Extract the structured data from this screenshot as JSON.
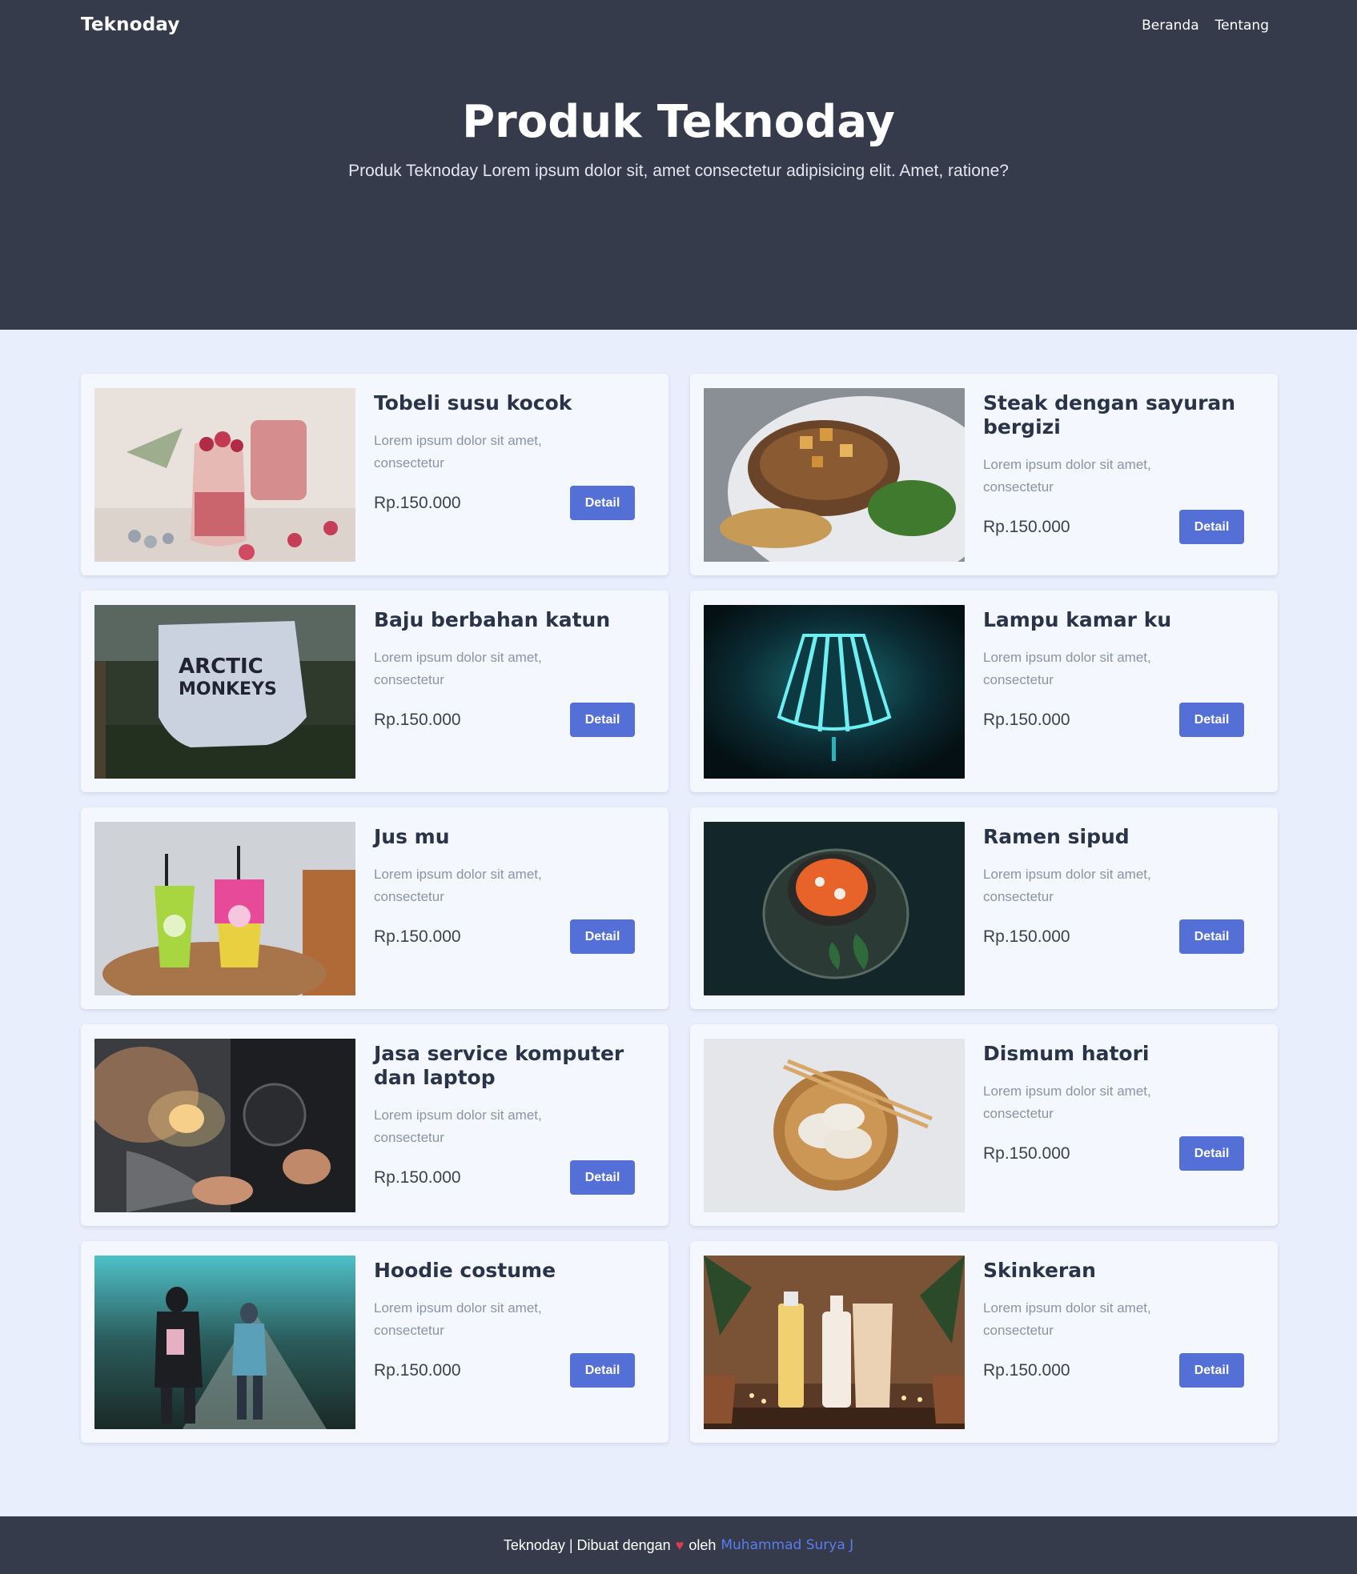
{
  "brand": "Teknoday",
  "nav": {
    "home": "Beranda",
    "about": "Tentang"
  },
  "hero": {
    "title": "Produk Teknoday",
    "subtitle": "Produk Teknoday Lorem ipsum dolor sit, amet consectetur adipisicing elit. Amet, ratione?"
  },
  "products": [
    {
      "title": "Tobeli susu kocok",
      "desc": "Lorem ipsum dolor sit amet, consectetur",
      "price": "Rp.150.000",
      "button": "Detail",
      "image": "smoothie-jars-image"
    },
    {
      "title": "Steak dengan sayuran bergizi",
      "desc": "Lorem ipsum dolor sit amet, consectetur",
      "price": "Rp.150.000",
      "button": "Detail",
      "image": "steak-plate-image"
    },
    {
      "title": "Baju berbahan katun",
      "desc": "Lorem ipsum dolor sit amet, consectetur",
      "price": "Rp.150.000",
      "button": "Detail",
      "image": "tshirt-image"
    },
    {
      "title": "Lampu kamar ku",
      "desc": "Lorem ipsum dolor sit amet, consectetur",
      "price": "Rp.150.000",
      "button": "Detail",
      "image": "lamp-image"
    },
    {
      "title": "Jus mu",
      "desc": "Lorem ipsum dolor sit amet, consectetur",
      "price": "Rp.150.000",
      "button": "Detail",
      "image": "juice-cups-image"
    },
    {
      "title": "Ramen sipud",
      "desc": "Lorem ipsum dolor sit amet, consectetur",
      "price": "Rp.150.000",
      "button": "Detail",
      "image": "ramen-bowl-image"
    },
    {
      "title": "Jasa service komputer dan laptop",
      "desc": "Lorem ipsum dolor sit amet, consectetur",
      "price": "Rp.150.000",
      "button": "Detail",
      "image": "computer-repair-image"
    },
    {
      "title": "Dismum hatori",
      "desc": "Lorem ipsum dolor sit amet, consectetur",
      "price": "Rp.150.000",
      "button": "Detail",
      "image": "dumplings-image"
    },
    {
      "title": "Hoodie costume",
      "desc": "Lorem ipsum dolor sit amet, consectetur",
      "price": "Rp.150.000",
      "button": "Detail",
      "image": "hoodie-walkers-image"
    },
    {
      "title": "Skinkeran",
      "desc": "Lorem ipsum dolor sit amet, consectetur",
      "price": "Rp.150.000",
      "button": "Detail",
      "image": "skincare-bottles-image"
    }
  ],
  "footer": {
    "text_before": "Teknoday | Dibuat dengan",
    "heart": "♥",
    "text_after": "oleh",
    "author": "Muhammad Surya J"
  },
  "colors": {
    "header_bg": "#353b4a",
    "page_bg": "#e8eefc",
    "card_bg": "#f5f7fe",
    "button": "#5470d6",
    "link": "#5a7df0",
    "heart": "#e03b4e"
  }
}
